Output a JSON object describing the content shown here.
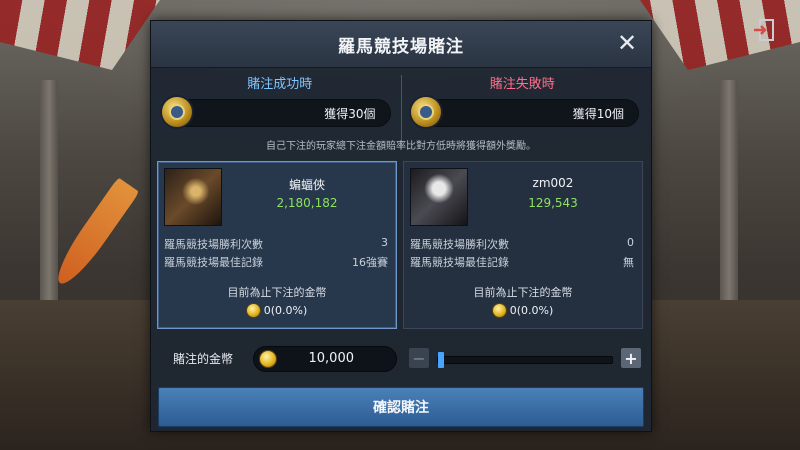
{
  "dialog": {
    "title": "羅馬競技場賭注"
  },
  "rewards": {
    "win": {
      "label": "賭注成功時",
      "amount": "獲得30個"
    },
    "lose": {
      "label": "賭注失敗時",
      "amount": "獲得10個"
    }
  },
  "note": "自己下注的玩家總下注金額賠率比對方低時將獲得額外獎勵。",
  "fighters": [
    {
      "name": "蝙蝠俠",
      "power": "2,180,182",
      "stats": [
        {
          "label": "羅馬競技場勝利次數",
          "value": "3"
        },
        {
          "label": "羅馬競技場最佳記錄",
          "value": "16強賽"
        }
      ],
      "bet_label": "目前為止下注的金幣",
      "bet_value": "0(0.0%)"
    },
    {
      "name": "zm002",
      "power": "129,543",
      "stats": [
        {
          "label": "羅馬競技場勝利次數",
          "value": "0"
        },
        {
          "label": "羅馬競技場最佳記錄",
          "value": "無"
        }
      ],
      "bet_label": "目前為止下注的金幣",
      "bet_value": "0(0.0%)"
    }
  ],
  "bet": {
    "label": "賭注的金幣",
    "amount": "10,000",
    "minus": "−",
    "plus": "+",
    "slider_fraction": 0
  },
  "confirm_label": "確認賭注",
  "colors": {
    "win": "#7fc5ff",
    "lose": "#ff6f8a",
    "power": "#8ee25f",
    "accent": "#4aa4ff"
  }
}
